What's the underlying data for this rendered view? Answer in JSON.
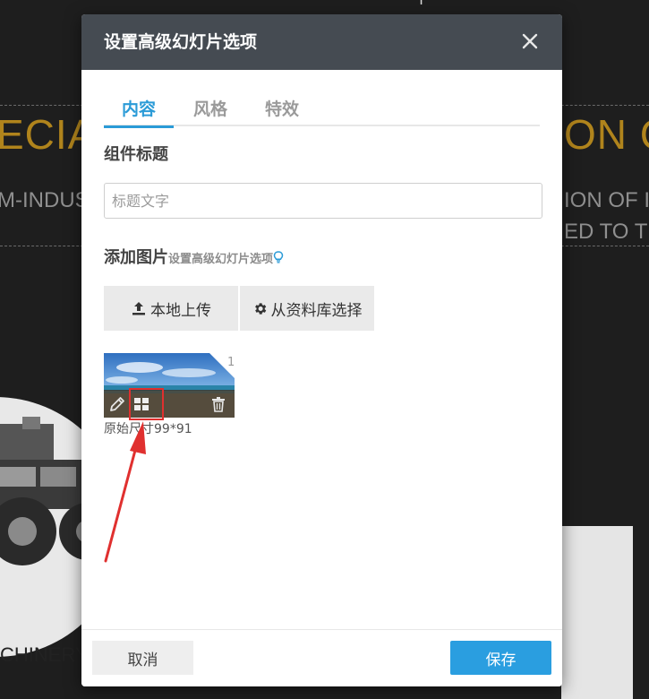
{
  "background": {
    "heading_left": "ECIA",
    "heading_right": "ON C",
    "sub_left": "M-INDUS",
    "sub_right_1": "ION OF I",
    "sub_right_2": "ED TO TH",
    "bottom_text": "CHINERY"
  },
  "dialog": {
    "title": "设置高级幻灯片选项",
    "close_label": "×",
    "tabs": [
      {
        "label": "内容",
        "active": true
      },
      {
        "label": "风格",
        "active": false
      },
      {
        "label": "特效",
        "active": false
      }
    ],
    "component_title": {
      "label": "组件标题",
      "placeholder": "标题文字",
      "value": ""
    },
    "add_images": {
      "label": "添加图片",
      "hint": "设置高级幻灯片选项"
    },
    "buttons": {
      "upload_local": "本地上传",
      "choose_library": "从资料库选择"
    },
    "thumbnail": {
      "index": "1",
      "size_text": "原始尺寸99*91"
    },
    "footer": {
      "cancel": "取消",
      "save": "保存"
    }
  },
  "colors": {
    "header_bg": "#454b52",
    "accent": "#2b9bd7",
    "save_button": "#2a9ee0",
    "annotation_red": "#e0302f",
    "background_gold": "#b0841c"
  },
  "icons": [
    "close-icon",
    "upload-icon",
    "gear-icon",
    "lightbulb-icon",
    "pencil-icon",
    "grid-icon",
    "trash-icon"
  ]
}
